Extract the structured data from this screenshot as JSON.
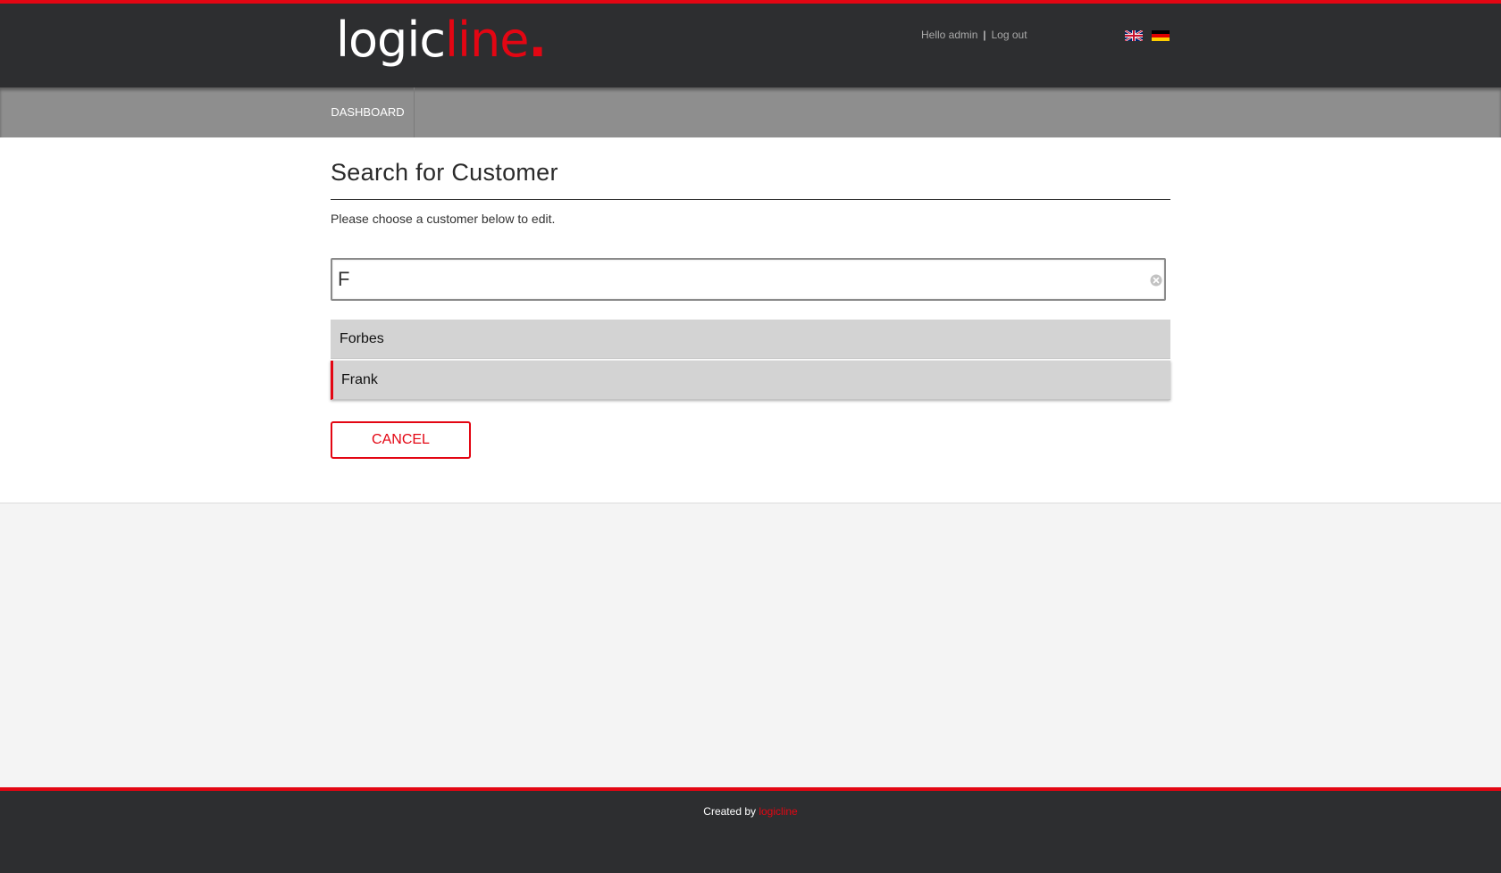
{
  "header": {
    "logo": {
      "part1": "logic",
      "part2": "line",
      "dot": "."
    },
    "greeting": "Hello admin",
    "separator": "|",
    "logout_label": "Log out",
    "languages": [
      {
        "icon": "flag-uk-icon",
        "code": "en"
      },
      {
        "icon": "flag-de-icon",
        "code": "de"
      }
    ]
  },
  "nav": {
    "items": [
      {
        "label": "DASHBOARD"
      }
    ]
  },
  "main": {
    "title": "Search for Customer",
    "intro": "Please choose a customer below to edit.",
    "search": {
      "value": "F",
      "clear_icon": "clear-circle-icon"
    },
    "results": [
      {
        "label": "Forbes",
        "active": false
      },
      {
        "label": "Frank",
        "active": true
      }
    ],
    "cancel_label": "CANCEL"
  },
  "footer": {
    "created_by": "Created by",
    "brand": "logicline"
  },
  "colors": {
    "accent_red": "#e30613",
    "header_bg": "#2d2e30",
    "nav_bg": "#8e8e8e",
    "result_bg": "#d3d3d3",
    "page_bg": "#f4f4f4"
  }
}
